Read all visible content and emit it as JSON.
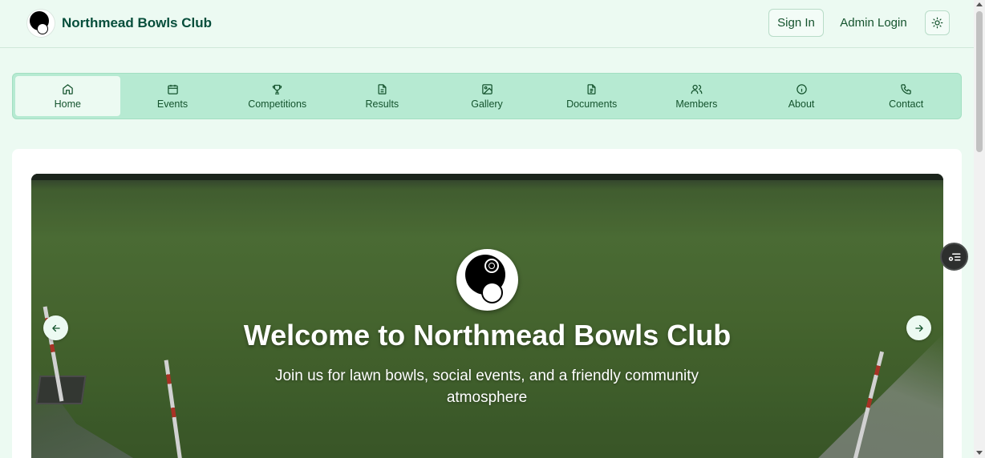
{
  "header": {
    "brand": "Northmead Bowls Club",
    "sign_in": "Sign In",
    "admin_login": "Admin Login",
    "theme_icon": "sun-icon"
  },
  "nav": {
    "items": [
      {
        "label": "Home",
        "icon": "home-icon",
        "active": true
      },
      {
        "label": "Events",
        "icon": "calendar-icon"
      },
      {
        "label": "Competitions",
        "icon": "trophy-icon"
      },
      {
        "label": "Results",
        "icon": "document-icon"
      },
      {
        "label": "Gallery",
        "icon": "image-icon"
      },
      {
        "label": "Documents",
        "icon": "file-text-icon"
      },
      {
        "label": "Members",
        "icon": "users-icon"
      },
      {
        "label": "About",
        "icon": "info-icon"
      },
      {
        "label": "Contact",
        "icon": "phone-icon"
      }
    ]
  },
  "hero": {
    "title": "Welcome to Northmead Bowls Club",
    "subtitle": "Join us for lawn bowls, social events, and a friendly community atmosphere",
    "prev_icon": "arrow-left-icon",
    "next_icon": "arrow-right-icon"
  },
  "fab": {
    "icon": "filter-list-icon"
  },
  "colors": {
    "accent": "#b6ead2",
    "page_bg": "#ecfaf2",
    "brand_text": "#064e3b"
  }
}
